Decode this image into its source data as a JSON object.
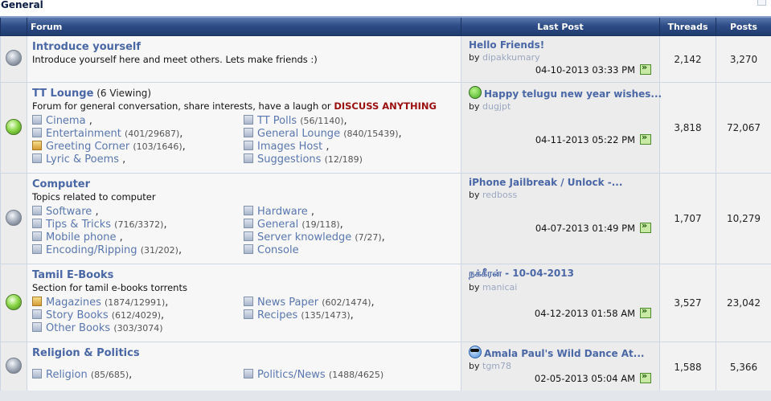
{
  "category": {
    "title": "General"
  },
  "headers": {
    "forum": "Forum",
    "last_post": "Last Post",
    "threads": "Threads",
    "posts": "Posts"
  },
  "forums": [
    {
      "title": "Introduce yourself",
      "viewing": "",
      "description": "Introduce yourself here and meet others. Lets make friends :)",
      "highlight": "",
      "status": "old",
      "subforums": [],
      "last_post": {
        "title": "Hello Friends!",
        "by_label": "by",
        "user": "dipakkumary",
        "date": "04-10-2013",
        "time": "03:33 PM",
        "icon": ""
      },
      "threads": "2,142",
      "posts": "3,270"
    },
    {
      "title": "TT Lounge",
      "viewing": "(6 Viewing)",
      "description": "Forum for general conversation, share interests, have a laugh or ",
      "highlight": "DISCUSS ANYTHING",
      "status": "new",
      "subforums": [
        {
          "name": "Cinema",
          "count": "",
          "sep": ",",
          "col": 0,
          "row": 0,
          "gold": false
        },
        {
          "name": "Entertainment",
          "count": "(401/29687)",
          "sep": ",",
          "col": 0,
          "row": 1,
          "gold": false
        },
        {
          "name": "Greeting Corner",
          "count": "(103/1646)",
          "sep": ",",
          "col": 0,
          "row": 2,
          "gold": true
        },
        {
          "name": "Lyric & Poems",
          "count": "",
          "sep": ",",
          "col": 0,
          "row": 3,
          "gold": false
        },
        {
          "name": "TT Polls",
          "count": "(56/1140)",
          "sep": ",",
          "col": 1,
          "row": 0,
          "gold": false
        },
        {
          "name": "General Lounge",
          "count": "(840/15439)",
          "sep": ",",
          "col": 1,
          "row": 1,
          "gold": false
        },
        {
          "name": "Images Host",
          "count": "",
          "sep": ",",
          "col": 1,
          "row": 2,
          "gold": false
        },
        {
          "name": "Suggestions",
          "count": "(12/189)",
          "sep": "",
          "col": 1,
          "row": 3,
          "gold": false
        }
      ],
      "last_post": {
        "title": "Happy telugu new year wishes...",
        "by_label": "by",
        "user": "dugjpt",
        "date": "04-11-2013",
        "time": "05:22 PM",
        "icon": "smile"
      },
      "threads": "3,818",
      "posts": "72,067"
    },
    {
      "title": "Computer",
      "viewing": "",
      "description": "Topics related to computer",
      "highlight": "",
      "status": "old",
      "subforums": [
        {
          "name": "Software",
          "count": "",
          "sep": ",",
          "col": 0,
          "row": 0,
          "gold": false
        },
        {
          "name": "Tips & Tricks",
          "count": "(716/3372)",
          "sep": ",",
          "col": 0,
          "row": 1,
          "gold": false
        },
        {
          "name": "Mobile phone",
          "count": "",
          "sep": ",",
          "col": 0,
          "row": 2,
          "gold": false
        },
        {
          "name": "Encoding/Ripping",
          "count": "(31/202)",
          "sep": ",",
          "col": 0,
          "row": 3,
          "gold": false
        },
        {
          "name": "Hardware",
          "count": "",
          "sep": ",",
          "col": 1,
          "row": 0,
          "gold": false
        },
        {
          "name": "General",
          "count": "(19/118)",
          "sep": ",",
          "col": 1,
          "row": 1,
          "gold": false
        },
        {
          "name": "Server knowledge",
          "count": "(7/27)",
          "sep": ",",
          "col": 1,
          "row": 2,
          "gold": false
        },
        {
          "name": "Console",
          "count": "",
          "sep": "",
          "col": 1,
          "row": 3,
          "gold": false
        }
      ],
      "last_post": {
        "title": "iPhone Jailbreak / Unlock -...",
        "by_label": "by",
        "user": "redboss",
        "date": "04-07-2013",
        "time": "01:49 PM",
        "icon": ""
      },
      "threads": "1,707",
      "posts": "10,279"
    },
    {
      "title": "Tamil E-Books",
      "viewing": "",
      "description": "Section for tamil e-books torrents",
      "highlight": "",
      "status": "new",
      "subforums": [
        {
          "name": "Magazines",
          "count": "(1874/12991)",
          "sep": ",",
          "col": 0,
          "row": 0,
          "gold": true
        },
        {
          "name": "Story Books",
          "count": "(612/4029)",
          "sep": ",",
          "col": 0,
          "row": 1,
          "gold": false
        },
        {
          "name": "Other Books",
          "count": "(303/3074)",
          "sep": "",
          "col": 0,
          "row": 2,
          "gold": false
        },
        {
          "name": "News Paper",
          "count": "(602/1474)",
          "sep": ",",
          "col": 1,
          "row": 0,
          "gold": false
        },
        {
          "name": "Recipes",
          "count": "(135/1473)",
          "sep": ",",
          "col": 1,
          "row": 1,
          "gold": false
        }
      ],
      "last_post": {
        "title": "நக்கீரன் - 10-04-2013",
        "by_label": "by",
        "user": "manicai",
        "date": "04-12-2013",
        "time": "01:58 AM",
        "icon": ""
      },
      "threads": "3,527",
      "posts": "23,042"
    },
    {
      "title": "Religion & Politics",
      "viewing": "",
      "description": "",
      "highlight": "",
      "status": "old",
      "subforums": [
        {
          "name": "Religion",
          "count": "(85/685)",
          "sep": ",",
          "col": 0,
          "row": 0,
          "gold": false
        },
        {
          "name": "Politics/News",
          "count": "(1488/4625)",
          "sep": "",
          "col": 1,
          "row": 0,
          "gold": false
        }
      ],
      "last_post": {
        "title": "Amala Paul's Wild Dance At...",
        "by_label": "by",
        "user": "tgm78",
        "date": "02-05-2013",
        "time": "05:04 AM",
        "icon": "cool"
      },
      "threads": "1,588",
      "posts": "5,366"
    }
  ]
}
